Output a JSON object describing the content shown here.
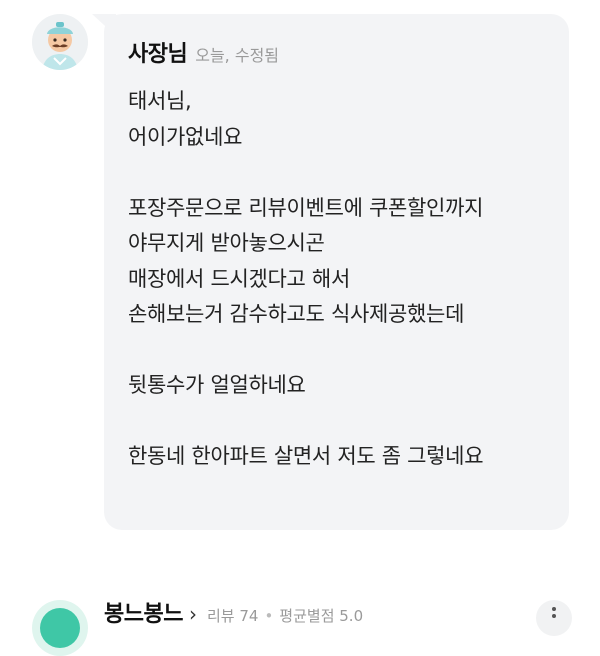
{
  "comment": {
    "author": "사장님",
    "meta": "오늘, 수정됨",
    "lines": [
      "태서님,",
      "어이가없네요",
      "",
      "포장주문으로 리뷰이벤트에 쿠폰할인까지",
      "야무지게 받아놓으시곤",
      "매장에서 드시겠다고 해서",
      "손해보는거 감수하고도 식사제공했는데",
      "",
      "뒷통수가 얼얼하네요",
      "",
      "한동네 한아파트 살면서 저도 좀 그렇네요"
    ]
  },
  "next_review": {
    "name": "봉느봉느",
    "chevron": "›",
    "review_count": "리뷰 74",
    "separator": "•",
    "avg_rating": "평균별점 5.0"
  },
  "colors": {
    "bubble_bg": "#f3f4f6",
    "meta_text": "#9a9a9a",
    "body_text": "#222222"
  }
}
